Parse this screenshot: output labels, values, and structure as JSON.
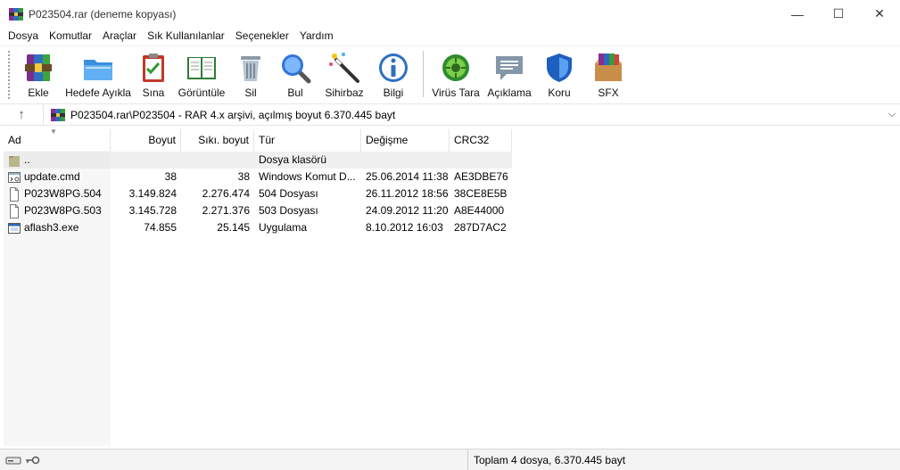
{
  "window": {
    "title": "P023504.rar (deneme kopyası)",
    "controls": {
      "minimize": "—",
      "maximize": "☐",
      "close": "✕"
    }
  },
  "menu": [
    "Dosya",
    "Komutlar",
    "Araçlar",
    "Sık Kullanılanlar",
    "Seçenekler",
    "Yardım"
  ],
  "toolbar": {
    "buttons": [
      {
        "label": "Ekle",
        "icon": "add-archive-icon"
      },
      {
        "label": "Hedefe Ayıkla",
        "icon": "extract-folder-icon"
      },
      {
        "label": "Sına",
        "icon": "test-clipboard-icon"
      },
      {
        "label": "Görüntüle",
        "icon": "view-book-icon"
      },
      {
        "label": "Sil",
        "icon": "trash-icon"
      },
      {
        "label": "Bul",
        "icon": "magnifier-icon"
      },
      {
        "label": "Sihirbaz",
        "icon": "wizard-wand-icon"
      },
      {
        "label": "Bilgi",
        "icon": "info-icon"
      },
      {
        "label": "Virüs Tara",
        "icon": "virus-scan-icon"
      },
      {
        "label": "Açıklama",
        "icon": "comment-icon"
      },
      {
        "label": "Koru",
        "icon": "shield-icon"
      },
      {
        "label": "SFX",
        "icon": "sfx-box-icon"
      }
    ]
  },
  "address": {
    "up": "↑",
    "path": "P023504.rar\\P023504 - RAR 4.x arşivi, açılmış boyut 6.370.445 bayt",
    "dropdown": "⌵"
  },
  "columns": {
    "name": "Ad",
    "size": "Boyut",
    "packed": "Sıkı. boyut",
    "type": "Tür",
    "modified": "Değişme",
    "crc": "CRC32"
  },
  "rows": [
    {
      "icon": "parent-folder-icon",
      "name": "..",
      "size": "",
      "packed": "",
      "type": "Dosya klasörü",
      "modified": "",
      "crc": ""
    },
    {
      "icon": "cmd-file-icon",
      "name": "update.cmd",
      "size": "38",
      "packed": "38",
      "type": "Windows Komut D...",
      "modified": "25.06.2014 11:38",
      "crc": "AE3DBE76"
    },
    {
      "icon": "generic-file-icon",
      "name": "P023W8PG.504",
      "size": "3.149.824",
      "packed": "2.276.474",
      "type": "504 Dosyası",
      "modified": "26.11.2012 18:56",
      "crc": "38CE8E5B"
    },
    {
      "icon": "generic-file-icon",
      "name": "P023W8PG.503",
      "size": "3.145.728",
      "packed": "2.271.376",
      "type": "503 Dosyası",
      "modified": "24.09.2012 11:20",
      "crc": "A8E44000"
    },
    {
      "icon": "exe-file-icon",
      "name": "aflash3.exe",
      "size": "74.855",
      "packed": "25.145",
      "type": "Uygulama",
      "modified": "8.10.2012 16:03",
      "crc": "287D7AC2"
    }
  ],
  "status": {
    "icons": [
      "drive-icon",
      "key-icon"
    ],
    "total": "Toplam 4 dosya, 6.370.445 bayt"
  }
}
